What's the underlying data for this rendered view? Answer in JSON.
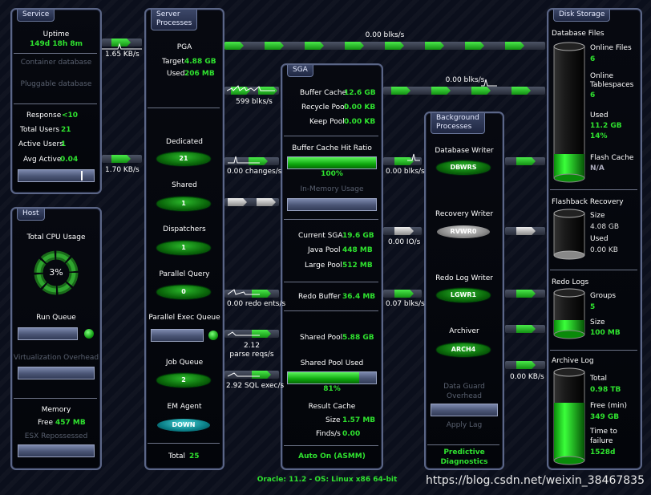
{
  "service": {
    "title": "Service",
    "uptime_label": "Uptime",
    "uptime_value": "149d 18h 8m",
    "container_db": "Container database",
    "pluggable_db": "Pluggable database",
    "response_label": "Response",
    "response_value": "<10",
    "total_users_label": "Total Users",
    "total_users_value": "21",
    "active_users_label": "Active Users",
    "active_users_value": "1",
    "avg_active_label": "Avg Active",
    "avg_active_value": "0.04",
    "avg_active_level": 0.8
  },
  "host": {
    "title": "Host",
    "cpu_label": "Total CPU Usage",
    "cpu_value": "3%",
    "cpu_fraction": 0.03,
    "run_queue_label": "Run Queue",
    "virt_label": "Virtualization Overhead",
    "memory_label": "Memory",
    "free_label": "Free",
    "free_value": "457 MB",
    "esx_label": "ESX Repossessed"
  },
  "server": {
    "title_line1": "Server",
    "title_line2": "Processes",
    "pga_label": "PGA",
    "target_label": "Target",
    "target_value": "4.88 GB",
    "used_label": "Used",
    "used_value": "206 MB",
    "dedicated_label": "Dedicated",
    "dedicated_value": "21",
    "shared_label": "Shared",
    "shared_value": "1",
    "dispatchers_label": "Dispatchers",
    "dispatchers_value": "1",
    "pq_label": "Parallel Query",
    "pq_value": "0",
    "pxq_label": "Parallel Exec Queue",
    "jobq_label": "Job Queue",
    "jobq_value": "2",
    "em_label": "EM Agent",
    "em_value": "DOWN",
    "total_label": "Total",
    "total_value": "25"
  },
  "sga": {
    "title": "SGA",
    "buffer_cache_label": "Buffer Cache",
    "buffer_cache_value": "12.6 GB",
    "recycle_pool_label": "Recycle Pool",
    "recycle_pool_value": "0.00 KB",
    "keep_pool_label": "Keep Pool",
    "keep_pool_value": "0.00 KB",
    "hit_ratio_label": "Buffer Cache Hit Ratio",
    "hit_ratio_value": "100%",
    "hit_ratio_fraction": 1.0,
    "inmemory_label": "In-Memory Usage",
    "current_sga_label": "Current SGA",
    "current_sga_value": "19.6 GB",
    "java_pool_label": "Java Pool",
    "java_pool_value": "448 MB",
    "large_pool_label": "Large Pool",
    "large_pool_value": "512 MB",
    "redo_buffer_label": "Redo Buffer",
    "redo_buffer_value": "36.4 MB",
    "shared_pool_label": "Shared Pool",
    "shared_pool_value": "5.88 GB",
    "shared_pool_used_label": "Shared Pool Used",
    "shared_pool_used_value": "81%",
    "shared_pool_used_fraction": 0.81,
    "result_cache_label": "Result Cache",
    "size_label": "Size",
    "size_value": "1.57 MB",
    "finds_label": "Finds/s",
    "finds_value": "0.00",
    "auto_on": "Auto On (ASMM)"
  },
  "bg": {
    "title_line1": "Background",
    "title_line2": "Processes",
    "dbw_label": "Database Writer",
    "dbw_value": "DBWRS",
    "rw_label": "Recovery Writer",
    "rw_value": "RVWR0",
    "lgwr_label": "Redo Log Writer",
    "lgwr_value": "LGWR1",
    "arch_label": "Archiver",
    "arch_value": "ARCH4",
    "dg_label_line1": "Data Guard",
    "dg_label_line2": "Overhead",
    "apply_lag_label": "Apply Lag",
    "predictive_line1": "Predictive",
    "predictive_line2": "Diagnostics"
  },
  "disk": {
    "title": "Disk Storage",
    "db_files_label": "Database Files",
    "online_files_label": "Online Files",
    "online_files_value": "6",
    "online_ts_label_line1": "Online",
    "online_ts_label_line2": "Tablespaces",
    "online_ts_value": "6",
    "used_label": "Used",
    "used_value": "11.2 GB",
    "used_pct": "14%",
    "db_files_fraction": 0.14,
    "flash_cache_label": "Flash Cache",
    "flash_cache_value": "N/A",
    "flashback_label": "Flashback Recovery",
    "fb_size_label": "Size",
    "fb_size_value": "4.08 GB",
    "fb_used_label": "Used",
    "fb_used_value": "0.00 KB",
    "redo_logs_label": "Redo Logs",
    "groups_label": "Groups",
    "groups_value": "5",
    "rl_size_label": "Size",
    "rl_size_value": "100 MB",
    "archive_label": "Archive Log",
    "total_label": "Total",
    "total_value": "0.98 TB",
    "free_label": "Free (min)",
    "free_value": "349 GB",
    "ttf_label_line1": "Time to",
    "ttf_label_line2": "failure",
    "ttf_value": "1528d",
    "archive_fraction": 0.65
  },
  "flows": {
    "f1": "1.65 KB/s",
    "f2": "1.70 KB/s",
    "f3": "0.00 blks/s",
    "f4": "599 blks/s",
    "f5": "0.00 blks/s",
    "f6": "0.00 changes/s",
    "f7": "0.00 blks/s",
    "f8": "0.00 IO/s",
    "f9": "0.00 redo ents/s",
    "f10": "0.07 blks/s",
    "f11_line1": "2.12",
    "f11_line2": "parse reqs/s",
    "f12": "2.92 SQL exec/s",
    "f13": "0.00 KB/s"
  },
  "footer": "Oracle: 11.2 - OS: Linux x86 64-bit",
  "watermark": "https://blog.csdn.net/weixin_38467835",
  "colors": {
    "accent_green": "#2fe22f",
    "panel_border": "#5b6687",
    "background": "#0b0f1c"
  }
}
